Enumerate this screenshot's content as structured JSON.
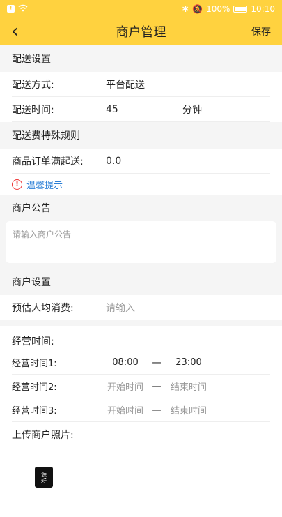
{
  "status_bar": {
    "battery": "100%",
    "time": "10:10"
  },
  "nav": {
    "title": "商户管理",
    "save": "保存"
  },
  "delivery": {
    "header": "配送设置",
    "method_label": "配送方式:",
    "method_value": "平台配送",
    "time_label": "配送时间:",
    "time_value": "45",
    "time_unit": "分钟"
  },
  "fee_rules": {
    "header": "配送费特殊规则",
    "min_label": "商品订单满起送:",
    "min_value": "0.0",
    "tip": "温馨提示"
  },
  "notice": {
    "header": "商户公告",
    "placeholder": "请输入商户公告"
  },
  "merchant": {
    "header": "商户设置",
    "avg_label": "预估人均消费:",
    "avg_placeholder": "请输入"
  },
  "hours": {
    "title": "经营时间:",
    "rows": [
      {
        "label": "经营时间1:",
        "start": "08:00",
        "dash": "一",
        "end": "23:00"
      },
      {
        "label": "经营时间2:",
        "start": "开始时间",
        "dash": "一",
        "end": "结束时间"
      },
      {
        "label": "经营时间3:",
        "start": "开始时间",
        "dash": "一",
        "end": "结束时间"
      }
    ]
  },
  "upload": {
    "label": "上传商户照片:"
  },
  "colors": {
    "accent": "#ffd23f",
    "link": "#2b7fd6",
    "warn": "#e33333"
  }
}
